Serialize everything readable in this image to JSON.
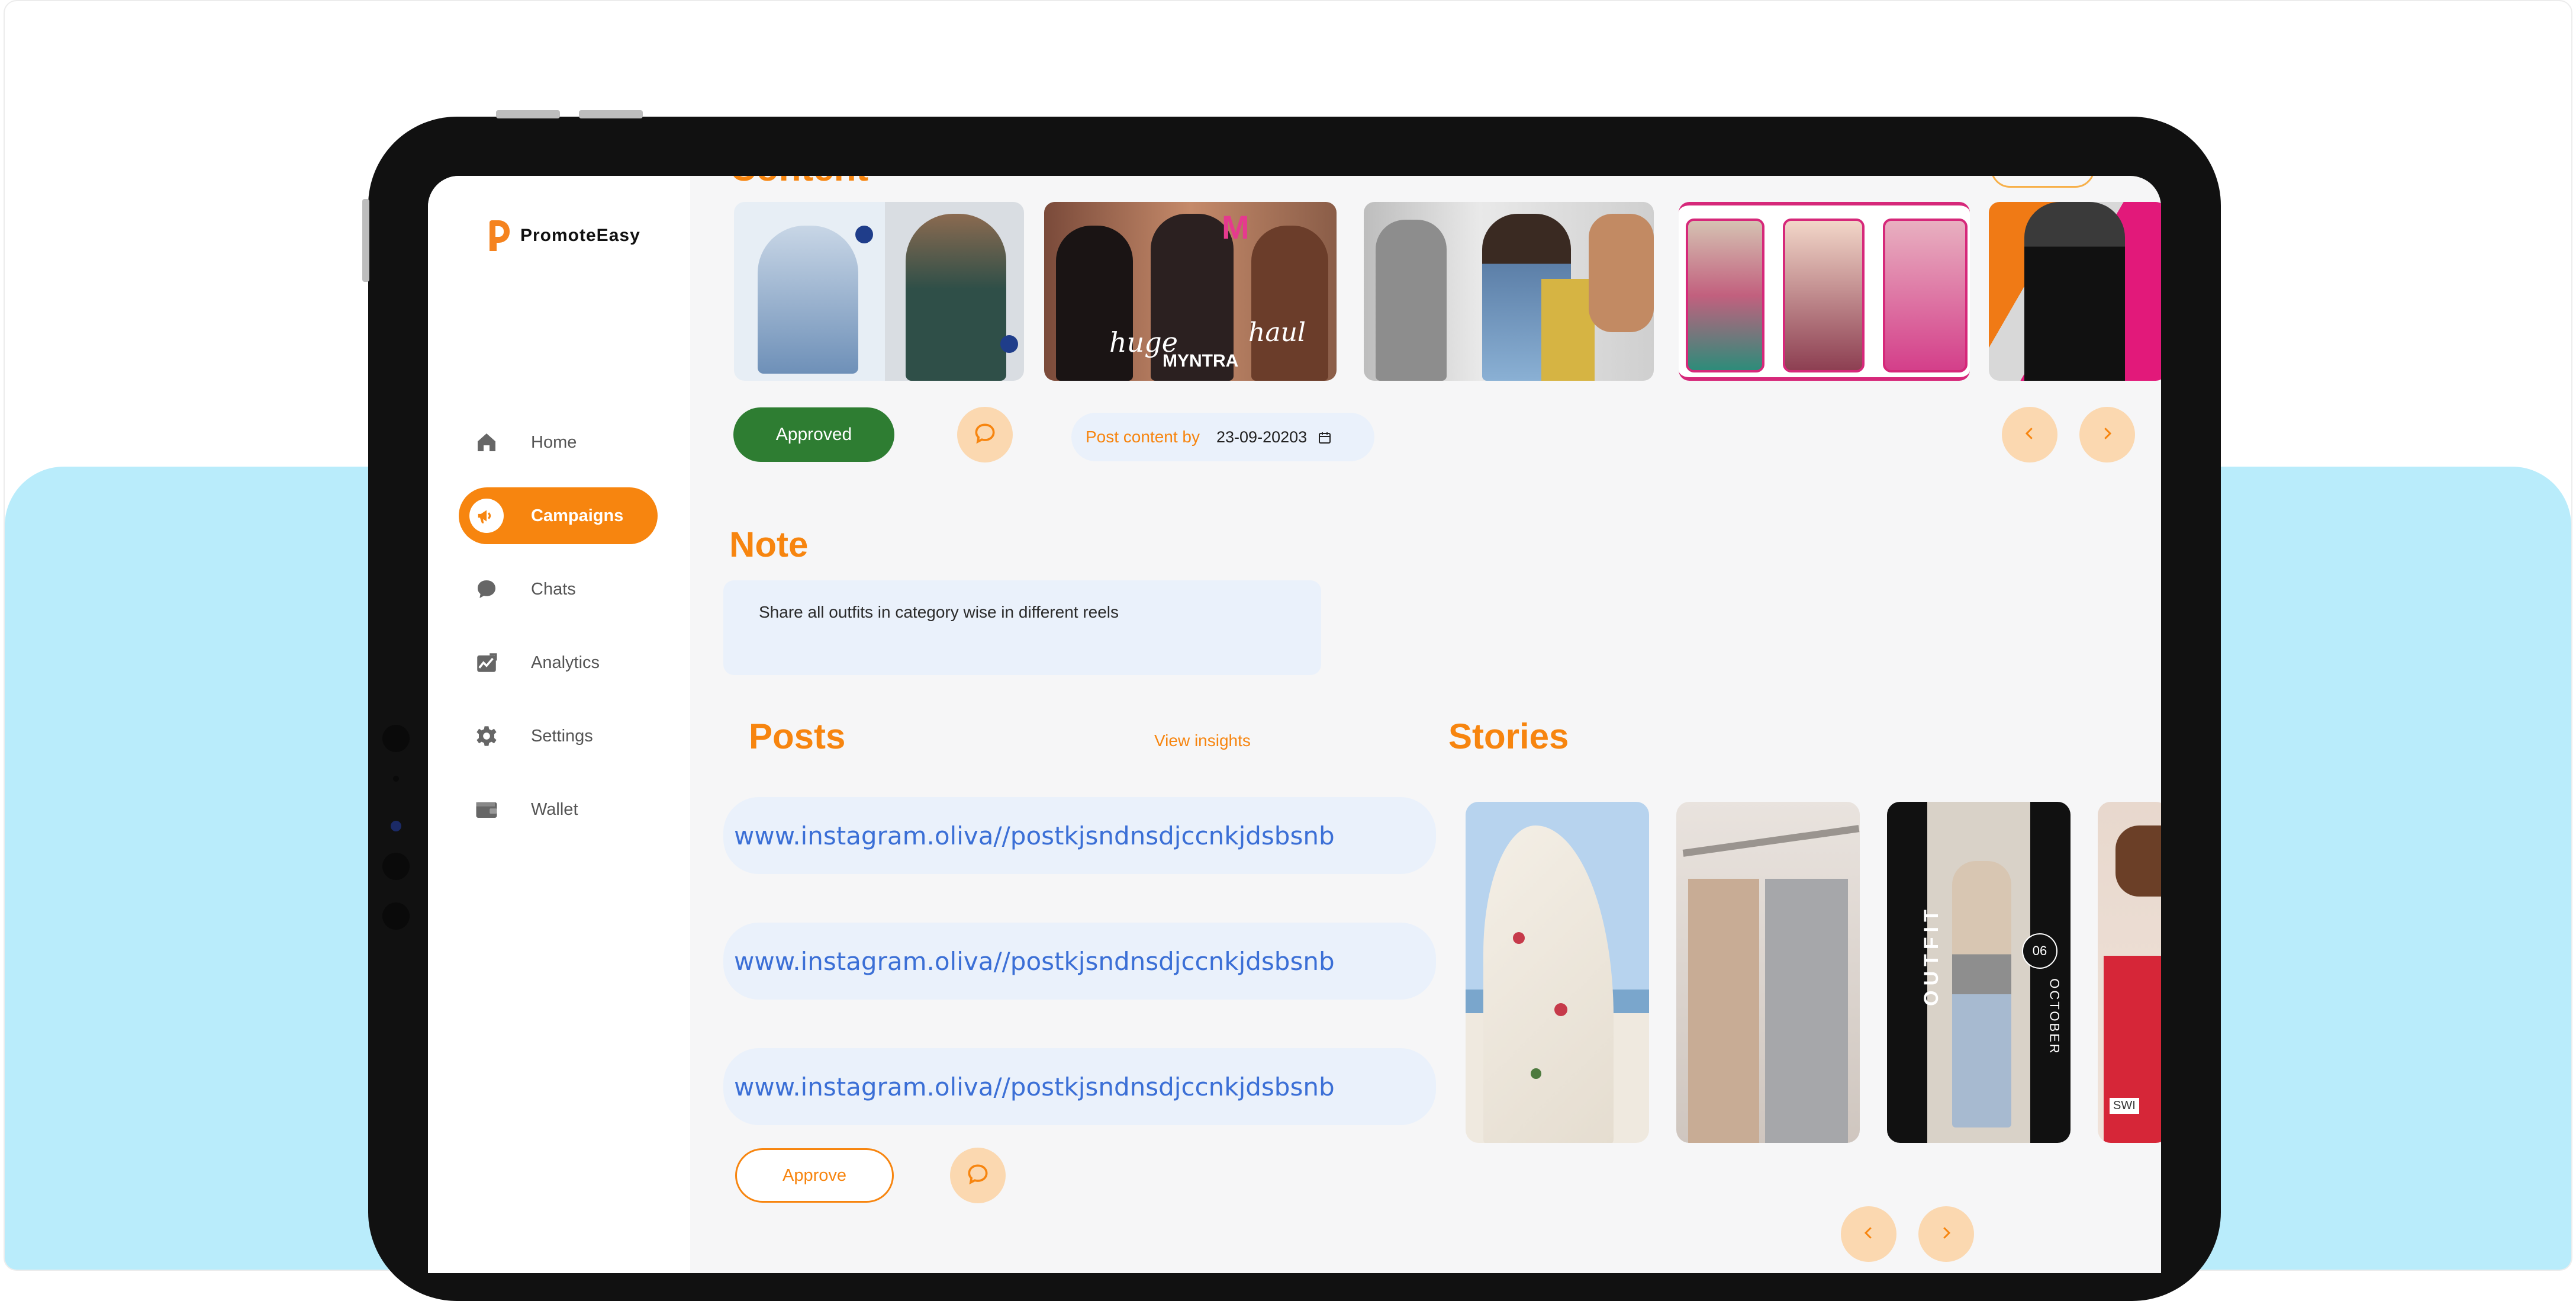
{
  "brand": {
    "name": "PromoteEasy",
    "accent": "#f7850f"
  },
  "sidebar": {
    "items": [
      {
        "label": "Home",
        "icon": "home-icon",
        "active": false
      },
      {
        "label": "Campaigns",
        "icon": "megaphone-icon",
        "active": true
      },
      {
        "label": "Chats",
        "icon": "chat-bubble-icon",
        "active": false
      },
      {
        "label": "Analytics",
        "icon": "analytics-icon",
        "active": false
      },
      {
        "label": "Settings",
        "icon": "gear-icon",
        "active": false
      },
      {
        "label": "Wallet",
        "icon": "wallet-icon",
        "active": false
      }
    ]
  },
  "content": {
    "section_title": "Content",
    "status_label": "Approved",
    "post_by_label": "Post content by",
    "post_by_date": "23-09-20203",
    "thumbnail_overlay": [
      "huge",
      "haul",
      "MYNTRA"
    ]
  },
  "note": {
    "title": "Note",
    "text": "Share all outfits in category wise in different reels"
  },
  "posts": {
    "title": "Posts",
    "view_insights": "View insights",
    "links": [
      "www.instagram.oliva//postkjsndnsdjccnkjdsbsnb",
      "www.instagram.oliva//postkjsndnsdjccnkjdsbsnb",
      "www.instagram.oliva//postkjsndnsdjccnkjdsbsnb"
    ],
    "approve_label": "Approve"
  },
  "stories": {
    "title": "Stories",
    "overlay": {
      "outfit": "OUTFIT",
      "day": "06",
      "month": "OCTOBER",
      "swipe": "SWI"
    }
  }
}
